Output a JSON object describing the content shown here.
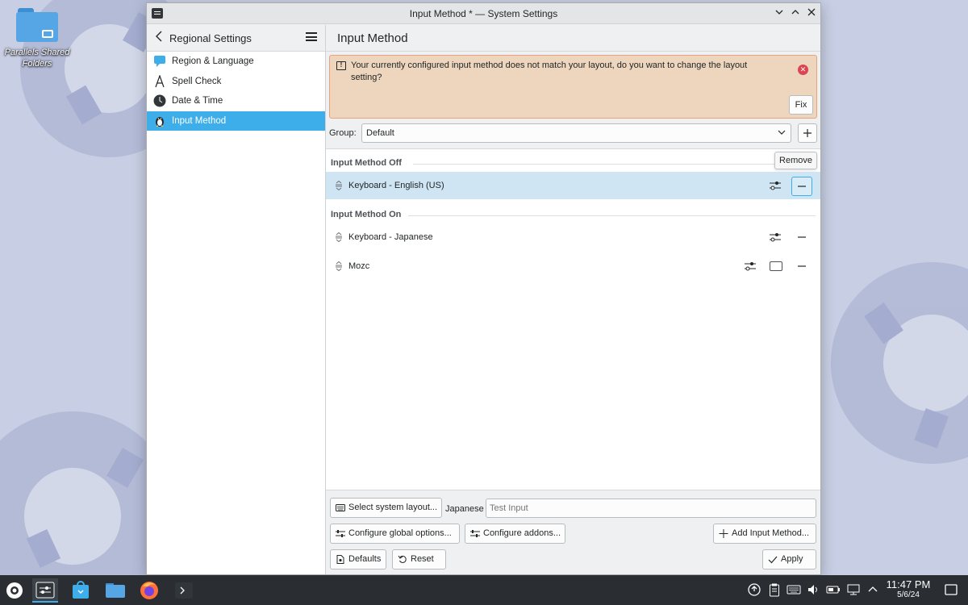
{
  "desktop": {
    "icon_label": "Parallels Shared Folders"
  },
  "window": {
    "title": "Input Method * — System Settings"
  },
  "sidebar": {
    "title": "Regional Settings",
    "items": [
      {
        "label": "Region & Language",
        "icon": "region-language-icon"
      },
      {
        "label": "Spell Check",
        "icon": "spell-check-icon"
      },
      {
        "label": "Date & Time",
        "icon": "clock-icon"
      },
      {
        "label": "Input Method",
        "icon": "tux-icon",
        "active": true
      }
    ]
  },
  "main": {
    "title": "Input Method",
    "warning": {
      "text": "Your currently configured input method does not match your layout, do you want to change the layout setting?",
      "fix_label": "Fix"
    },
    "group": {
      "label": "Group:",
      "value": "Default"
    },
    "sections": {
      "off_title": "Input Method Off",
      "on_title": "Input Method On"
    },
    "rows": [
      {
        "label": "Keyboard - English (US)"
      },
      {
        "label": "Keyboard - Japanese"
      },
      {
        "label": "Mozc"
      }
    ],
    "tooltip": "Remove",
    "bottom": {
      "select_layout": "Select system layout...",
      "test_lang": "Japanese",
      "test_placeholder": "Test Input",
      "configure_global": "Configure global options...",
      "configure_addons": "Configure addons...",
      "add_input_method": "Add Input Method...",
      "defaults": "Defaults",
      "reset": "Reset",
      "apply": "Apply"
    }
  },
  "taskbar": {
    "time": "11:47 PM",
    "date": "5/6/24"
  },
  "colors": {
    "accent": "#3daee9",
    "warning_bg": "#edd6bd",
    "taskbar": "#2a2e32"
  }
}
